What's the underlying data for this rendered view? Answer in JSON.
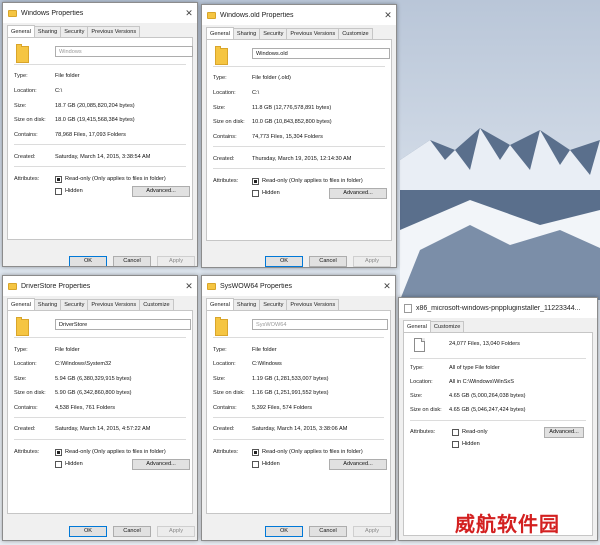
{
  "background": {
    "sky": "#cfdce9",
    "mountain": "#5a6f8c",
    "snow": "#f2f5f9"
  },
  "labels": {
    "type": "Type:",
    "location": "Location:",
    "size": "Size:",
    "size_on_disk": "Size on disk:",
    "contains": "Contains:",
    "created": "Created:",
    "attributes": "Attributes:",
    "readonly": "Read-only (Only applies to files in folder)",
    "readonly_short": "Read-only",
    "hidden": "Hidden",
    "advanced": "Advanced...",
    "ok": "OK",
    "cancel": "Cancel",
    "apply": "Apply"
  },
  "windows": {
    "windows": {
      "title": "Windows Properties",
      "tabs": [
        "General",
        "Sharing",
        "Security",
        "Previous Versions"
      ],
      "name": "Windows",
      "type": "File folder",
      "location": "C:\\",
      "size": "18.7 GB (20,085,820,204 bytes)",
      "size_on_disk": "18.0 GB (19,415,568,384 bytes)",
      "contains": "78,968 Files, 17,093 Folders",
      "created": "Saturday, March 14, 2015, 3:38:54 AM"
    },
    "windows_old": {
      "title": "Windows.old Properties",
      "tabs": [
        "General",
        "Sharing",
        "Security",
        "Previous Versions",
        "Customize"
      ],
      "name": "Windows.old",
      "type": "File folder (.old)",
      "location": "C:\\",
      "size": "11.8 GB (12,776,578,891 bytes)",
      "size_on_disk": "10.0 GB (10,843,852,800 bytes)",
      "contains": "74,773 Files, 15,304 Folders",
      "created": "Thursday, March 19, 2015, 12:14:30 AM"
    },
    "driverstore": {
      "title": "DriverStore Properties",
      "tabs": [
        "General",
        "Sharing",
        "Security",
        "Previous Versions",
        "Customize"
      ],
      "name": "DriverStore",
      "type": "File folder",
      "location": "C:\\Windows\\System32",
      "size": "5.94 GB (6,380,329,915 bytes)",
      "size_on_disk": "5.90 GB (6,342,860,800 bytes)",
      "contains": "4,538 Files, 761 Folders",
      "created": "Saturday, March 14, 2015, 4:57:22 AM"
    },
    "syswow64": {
      "title": "SysWOW64 Properties",
      "tabs": [
        "General",
        "Sharing",
        "Security",
        "Previous Versions"
      ],
      "name": "SysWOW64",
      "type": "File folder",
      "location": "C:\\Windows",
      "size": "1.19 GB (1,281,533,007 bytes)",
      "size_on_disk": "1.16 GB (1,251,991,552 bytes)",
      "contains": "5,392 Files, 574 Folders",
      "created": "Saturday, March 14, 2015, 3:38:06 AM"
    },
    "winsxs": {
      "title": "x86_microsoft-windows-pnppluginstaller_11223344...",
      "tabs": [
        "General",
        "Customize"
      ],
      "contains": "24,077 Files, 13,040 Folders",
      "type": "All of type File folder",
      "location": "All in C:\\Windows\\WinSxS",
      "size": "4.65 GB (5,000,264,038 bytes)",
      "size_on_disk": "4.65 GB (5,046,247,424 bytes)"
    }
  },
  "watermark": "威航软件园"
}
